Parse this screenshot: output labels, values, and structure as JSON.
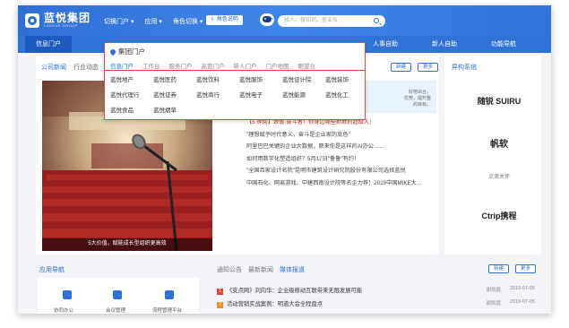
{
  "header": {
    "brand": "蓝悦集团",
    "brand_sub": "LANYUE GROUP",
    "menu": [
      "切换门户 ▾",
      "应用 ▾",
      "角色切换 ▾"
    ],
    "role_pill": "⇩ 角色说明",
    "search_placeholder": "找人、搜知识、查业仪"
  },
  "nav": {
    "active": "信息门户",
    "items": [
      "人事自助",
      "新人自助",
      "功能导航"
    ]
  },
  "dropdown": {
    "title": "集团门户",
    "tabs": [
      "信息门户",
      "工作台",
      "服务门户",
      "高管门户",
      "新人门户",
      "门户地图",
      "眼望台"
    ],
    "items": [
      "蓝悦地产",
      "蓝悦医药",
      "蓝悦饮料",
      "蓝悦服饰",
      "蓝悦设计院",
      "蓝悦装饰",
      "蓝悦代理行",
      "蓝悦证券",
      "蓝悦商行",
      "蓝悦电子",
      "蓝悦能源",
      "蓝悦化工",
      "蓝悦食品",
      "蓝悦烟草"
    ]
  },
  "news": {
    "tabs": [
      "公司新闻",
      "行业动态"
    ],
    "new_btn": "新建",
    "more_btn": "更多",
    "right_snippet": [
      "好地出台，",
      "优势，提升整",
      "的目标。"
    ],
    "caption": "5大价值，赋能成长型组织更高效",
    "list": [
      "【5 钟阅】致敬·奋斗者！你身边哪些默默的超级人！",
      "\"理想赋予时代意义，奋斗是企业家的底色\"",
      "阿里巴巴关键的企业大数据，原来你是这样的AI办公……",
      "如何用数字化塑造组织？5月17日\"鲁鲁\"有约！",
      "\"全国百家设计名院\"昆明市建筑设计研究院股份有限公司选择蓝悦",
      "中国石化、网易游戏、中建西南设计院等名企力荐！2019中国MIKE大..."
    ]
  },
  "partners": {
    "title": "异构系统",
    "items": [
      "随锐 SUIRU",
      "帆软",
      "点滴关怀",
      "Ctrip携程"
    ]
  },
  "bottom": {
    "app_nav_title": "应用导航",
    "app_labels": [
      "协同办公",
      "会议管理",
      "流程管理平台"
    ],
    "tabs": [
      "通知公告",
      "最新新闻",
      "媒体报道"
    ],
    "new_btn": "新建",
    "more_btn": "更多",
    "rows": [
      {
        "num": "1",
        "text": "《支点网》刘向华：企业级移动互联带来无限发展可能",
        "author": "谢凯霞",
        "date": "2019-07-05"
      },
      {
        "num": "2",
        "text": "活动营销实战案例：明道大会全程盘点",
        "author": "谢凯霞",
        "date": "2019-07-05"
      }
    ]
  },
  "colors": {
    "brand": "#2e6fd8",
    "highlight": "#e0463d"
  }
}
